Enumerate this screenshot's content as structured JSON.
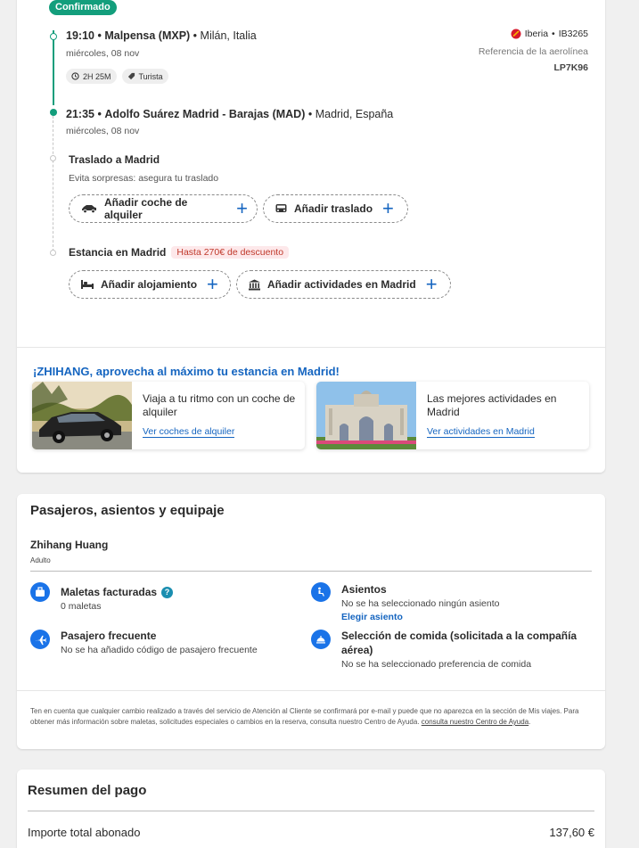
{
  "flight": {
    "status_badge": "Confirmado",
    "departure": {
      "time": "19:10",
      "airport": "Malpensa (MXP)",
      "city": "Milán, Italia",
      "date": "miércoles, 08 nov"
    },
    "duration": "2H 25M",
    "cabin": "Turista",
    "arrival": {
      "time": "21:35",
      "airport": "Adolfo Suárez Madrid - Barajas (MAD)",
      "city": "Madrid, España",
      "date": "miércoles, 08 nov"
    },
    "airline": "Iberia",
    "flight_number": "IB3265",
    "ref_label": "Referencia de la aerolínea",
    "ref_value": "LP7K96"
  },
  "transfer": {
    "title": "Traslado a Madrid",
    "subtitle": "Evita sorpresas: asegura tu traslado",
    "car_rental_label": "Añadir coche de alquiler",
    "transfer_label": "Añadir traslado"
  },
  "stay": {
    "title": "Estancia en Madrid",
    "discount": "Hasta 270€ de descuento",
    "accommodation_label": "Añadir alojamiento",
    "activities_label": "Añadir actividades en Madrid"
  },
  "promo": {
    "title": "¡ZHIHANG, aprovecha al máximo tu estancia en Madrid!",
    "cards": [
      {
        "text": "Viaja a tu ritmo con un coche de alquiler",
        "link": "Ver coches de alquiler"
      },
      {
        "text": "Las mejores actividades en Madrid",
        "link": "Ver actividades en Madrid"
      }
    ]
  },
  "passengers": {
    "title": "Pasajeros, asientos y equipaje",
    "name": "Zhihang Huang",
    "type": "Adulto",
    "bags_title": "Maletas facturadas",
    "bags_value": "0 maletas",
    "seats_title": "Asientos",
    "seats_value": "No se ha seleccionado ningún asiento",
    "seats_link": "Elegir asiento",
    "frequent_title": "Pasajero frecuente",
    "frequent_value": "No se ha añadido código de pasajero frecuente",
    "meal_title": "Selección de comida (solicitada a la compañía aérea)",
    "meal_value": "No se ha seleccionado preferencia de comida",
    "notice_text": "Ten en cuenta que cualquier cambio realizado a través del servicio de Atención al Cliente se confirmará por e-mail y puede que no aparezca en la sección de Mis viajes. Para obtener más información sobre maletas, solicitudes especiales o cambios en la reserva, consulta nuestro Centro de Ayuda.",
    "notice_link": "consulta nuestro Centro de Ayuda",
    "notice_end": "."
  },
  "payment": {
    "title": "Resumen del pago",
    "total_label": "Importe total abonado",
    "total_value": "137,60 €"
  },
  "colors": {
    "accent_green": "#139e7c",
    "link_blue": "#1565c0",
    "icon_blue": "#1a73e8",
    "iberia_red": "#d7192d"
  }
}
